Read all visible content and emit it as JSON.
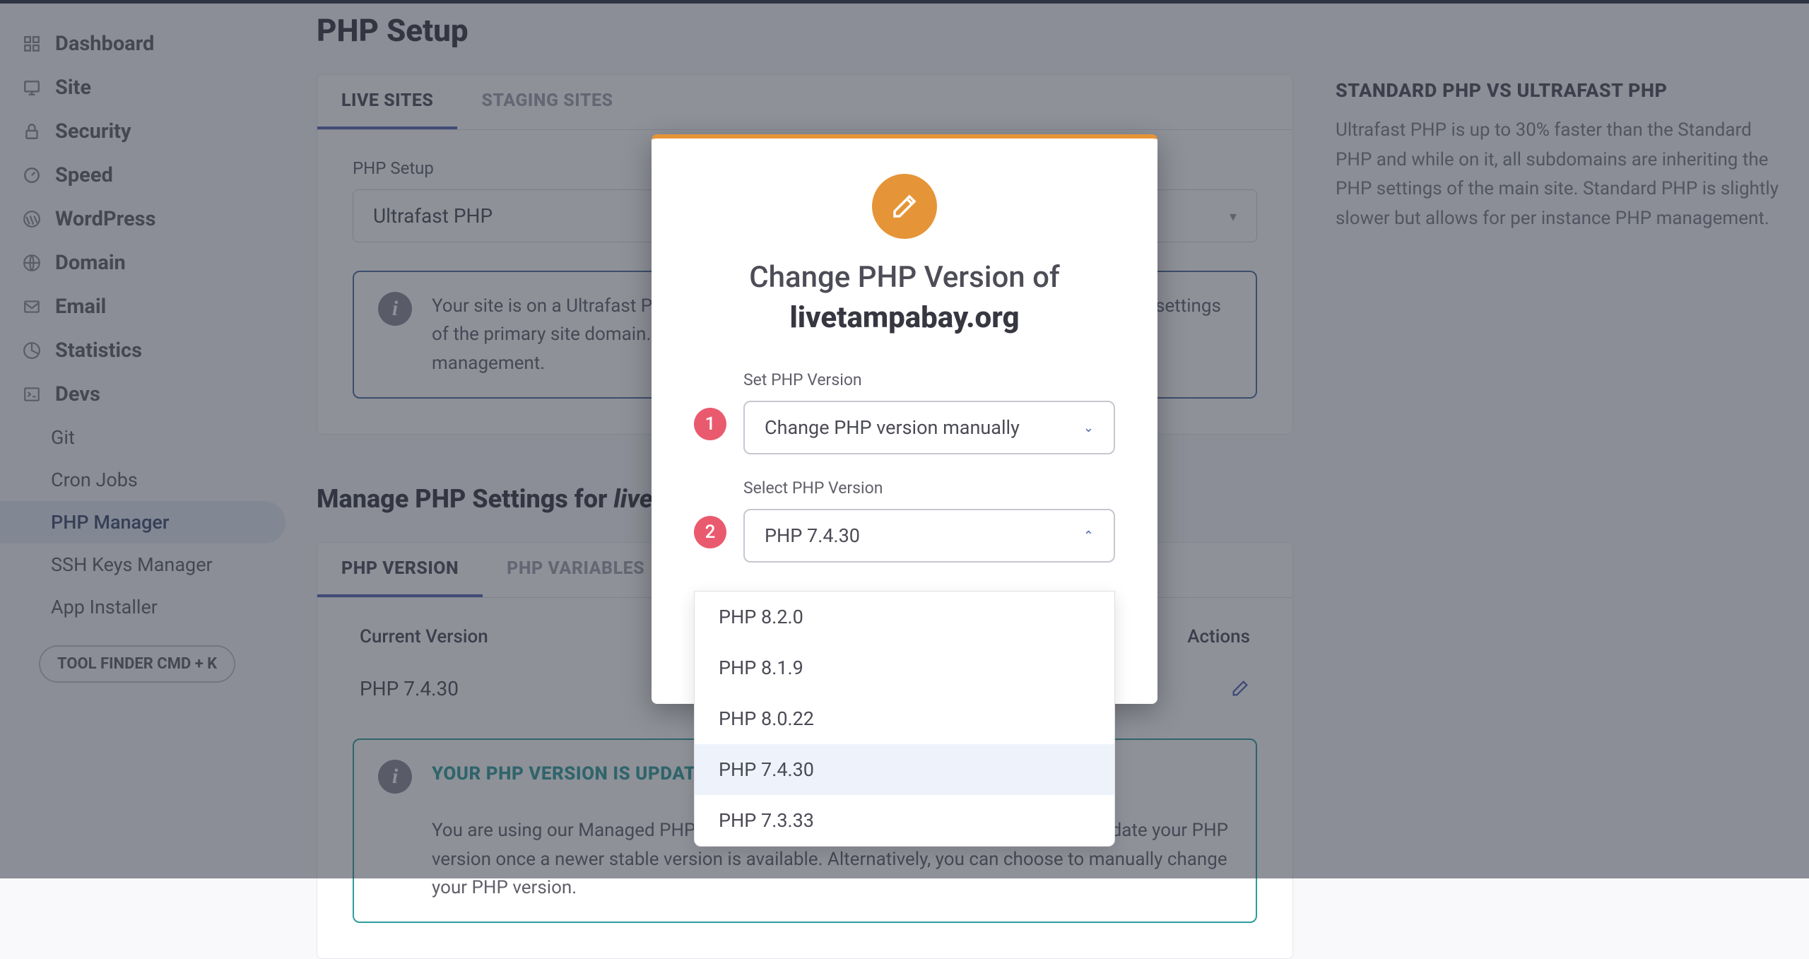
{
  "sidebar": {
    "items": [
      {
        "label": "Dashboard"
      },
      {
        "label": "Site"
      },
      {
        "label": "Security"
      },
      {
        "label": "Speed"
      },
      {
        "label": "WordPress"
      },
      {
        "label": "Domain"
      },
      {
        "label": "Email"
      },
      {
        "label": "Statistics"
      },
      {
        "label": "Devs"
      }
    ],
    "sub": [
      {
        "label": "Git"
      },
      {
        "label": "Cron Jobs"
      },
      {
        "label": "PHP Manager"
      },
      {
        "label": "SSH Keys Manager"
      },
      {
        "label": "App Installer"
      }
    ],
    "tool_finder": "TOOL FINDER CMD + K"
  },
  "page": {
    "title": "PHP Setup",
    "tabs": [
      {
        "label": "LIVE SITES"
      },
      {
        "label": "STAGING SITES"
      }
    ],
    "php_setup_label": "PHP Setup",
    "php_setup_value": "Ultrafast PHP",
    "info_text": "Your site is on a Ultrafast PHP setup meaning that all subdomains are inheriting the PHP settings of the primary site domain. Switch to Standard PHP setup, if you want per instance PHP management.",
    "section2_title": "Manage PHP Settings for ",
    "section2_title_em": "livetampabay.org",
    "tabs2": [
      {
        "label": "PHP VERSION"
      },
      {
        "label": "PHP VARIABLES"
      }
    ],
    "table": {
      "col1": "Current Version",
      "col2": "Actions",
      "row1": "PHP 7.4.30"
    },
    "callout2": {
      "title": "YOUR PHP VERSION IS UPDATED AUTOMATICALLY",
      "body": "You are using our Managed PHP service, which means that we will automatically update your PHP version once a newer stable version is available. Alternatively, you can choose to manually change your PHP version."
    }
  },
  "aside": {
    "title": "STANDARD PHP VS ULTRAFAST PHP",
    "body": "Ultrafast PHP is up to 30% faster than the Standard PHP and while on it, all subdomains are inheriting the PHP settings of the main site. Standard PHP is slightly slower but allows for per instance PHP management."
  },
  "modal": {
    "title": "Change PHP Version of",
    "site": "livetampabay.org",
    "field1": {
      "label": "Set PHP Version",
      "value": "Change PHP version manually"
    },
    "field2": {
      "label": "Select PHP Version",
      "value": "PHP 7.4.30"
    },
    "options": [
      "PHP 8.2.0",
      "PHP 8.1.9",
      "PHP 8.0.22",
      "PHP 7.4.30",
      "PHP 7.3.33"
    ]
  }
}
